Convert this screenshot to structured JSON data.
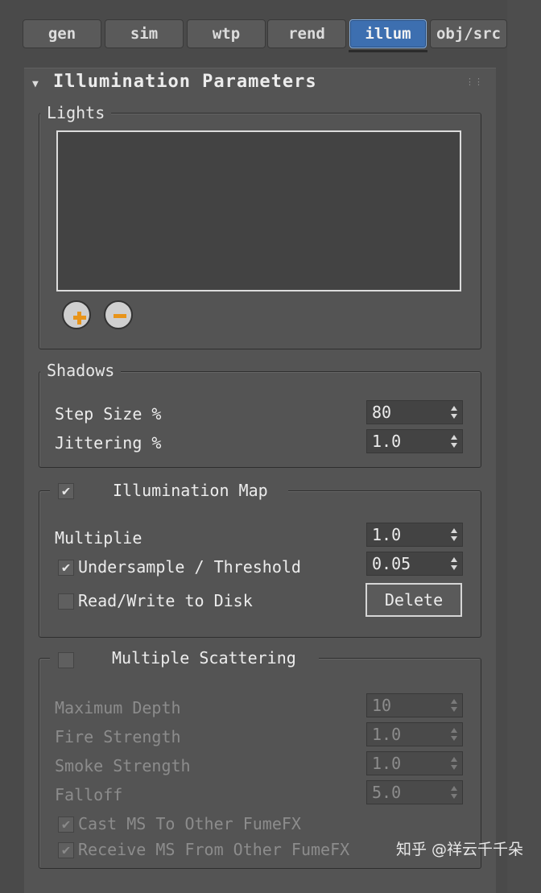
{
  "tabs": [
    {
      "label": "gen",
      "active": false
    },
    {
      "label": "sim",
      "active": false
    },
    {
      "label": "wtp",
      "active": false
    },
    {
      "label": "rend",
      "active": false
    },
    {
      "label": "illum",
      "active": true
    },
    {
      "label": "obj/src",
      "active": false
    }
  ],
  "rollout": {
    "title": "Illumination Parameters"
  },
  "lights": {
    "group_label": "Lights",
    "add_icon": "plus-icon",
    "remove_icon": "minus-icon"
  },
  "shadows": {
    "group_label": "Shadows",
    "step_size": {
      "label": "Step Size %",
      "value": "80"
    },
    "jittering": {
      "label": "Jittering %",
      "value": "1.0"
    }
  },
  "illum_map": {
    "group_label": "Illumination Map",
    "enabled": true,
    "multiplier": {
      "label": "Multiplie",
      "value": "1.0"
    },
    "undersample": {
      "label": "Undersample / Threshold",
      "checked": true,
      "value": "0.05"
    },
    "readwrite": {
      "label": "Read/Write to Disk",
      "checked": false
    },
    "delete_label": "Delete"
  },
  "multiple_scattering": {
    "group_label": "Multiple Scattering",
    "enabled": false,
    "max_depth": {
      "label": "Maximum Depth",
      "value": "10"
    },
    "fire_strength": {
      "label": "Fire Strength",
      "value": "1.0"
    },
    "smoke_strength": {
      "label": "Smoke Strength",
      "value": "1.0"
    },
    "falloff": {
      "label": "Falloff",
      "value": "5.0"
    },
    "cast_ms": {
      "label": "Cast MS To Other FumeFX",
      "checked": true
    },
    "receive_ms": {
      "label": "Receive MS From Other FumeFX",
      "checked": true
    }
  },
  "watermark": "知乎 @祥云千千朵",
  "colors": {
    "accent": "#3d6fb0",
    "icon_orange": "#e8941a",
    "panel": "#545454"
  }
}
